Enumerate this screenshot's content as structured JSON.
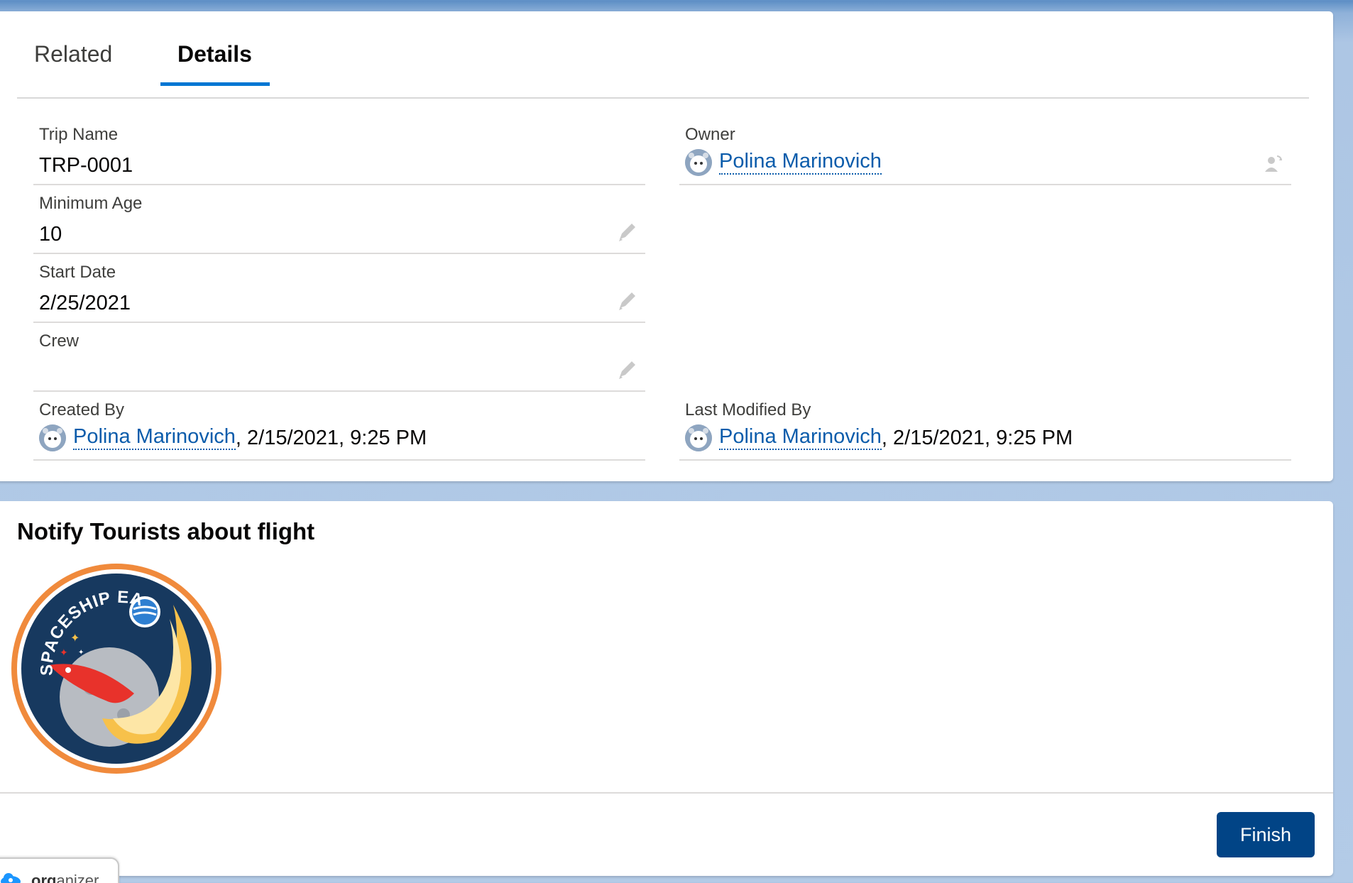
{
  "tabs": [
    {
      "label": "Related",
      "active": false
    },
    {
      "label": "Details",
      "active": true
    }
  ],
  "fields": {
    "trip_name": {
      "label": "Trip Name",
      "value": "TRP-0001"
    },
    "minimum_age": {
      "label": "Minimum Age",
      "value": "10"
    },
    "start_date": {
      "label": "Start Date",
      "value": "2/25/2021"
    },
    "crew": {
      "label": "Crew",
      "value": ""
    },
    "owner": {
      "label": "Owner",
      "user": "Polina Marinovich"
    },
    "created_by": {
      "label": "Created By",
      "user": "Polina Marinovich",
      "datetime": ", 2/15/2021, 9:25 PM"
    },
    "last_modified_by": {
      "label": "Last Modified By",
      "user": "Polina Marinovich",
      "datetime": ", 2/15/2021, 9:25 PM"
    }
  },
  "flow": {
    "title": "Notify Tourists about flight",
    "badge_text": "SPACESHIP EAC",
    "finish_label": "Finish"
  },
  "organizer": {
    "prefix": "org",
    "suffix": "anizer"
  },
  "colors": {
    "accent": "#0176d3",
    "link": "#0b5cab",
    "finish_button": "#014486",
    "badge_border": "#f08a3c",
    "badge_bg": "#17395f"
  }
}
